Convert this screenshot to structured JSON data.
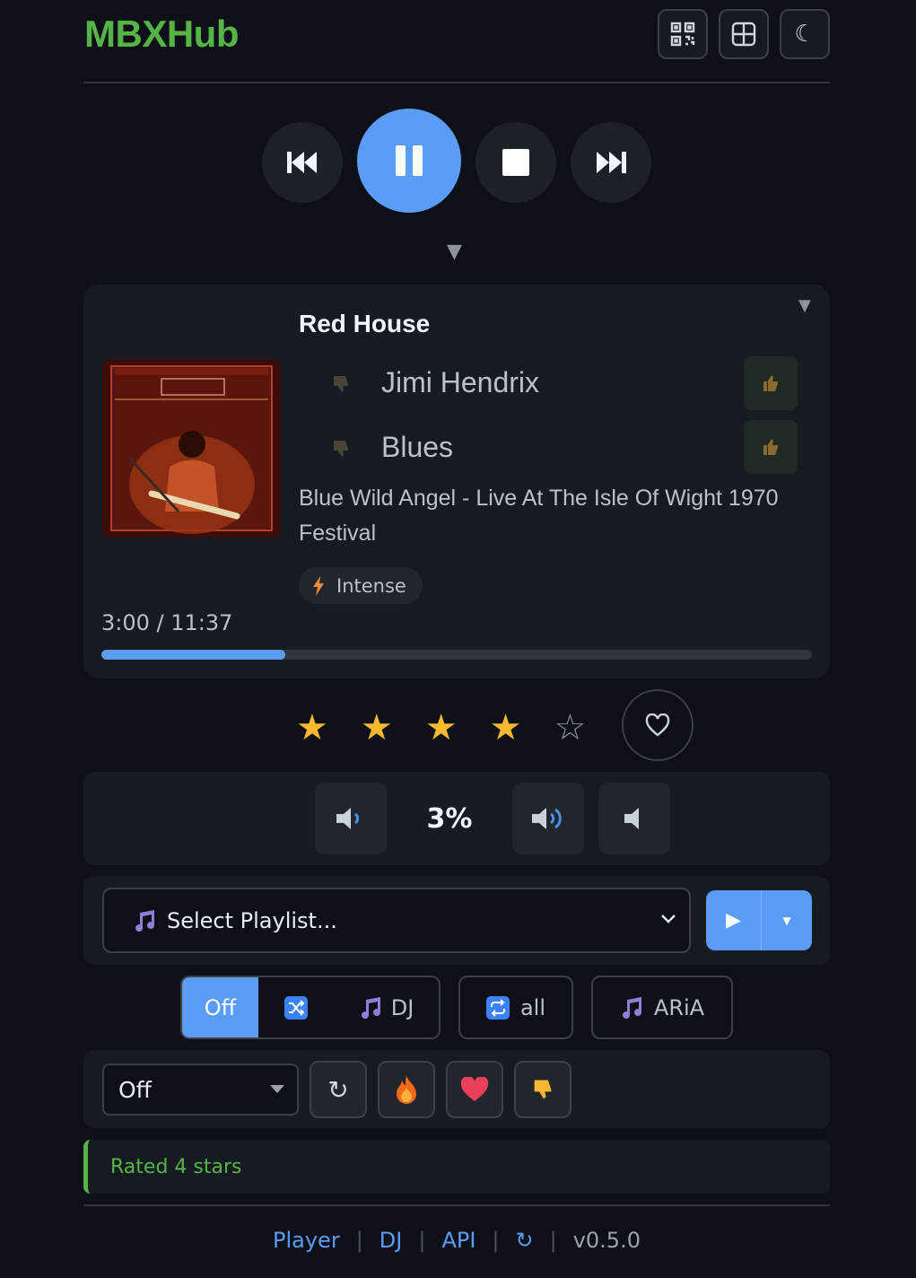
{
  "header": {
    "brand": "MBXHub",
    "buttons": [
      {
        "name": "qr-code-icon"
      },
      {
        "name": "grid-icon"
      },
      {
        "name": "moon-icon",
        "glyph": "☾"
      }
    ]
  },
  "transport": {
    "buttons": [
      "previous-icon",
      "pause-icon",
      "stop-icon",
      "next-icon"
    ],
    "expand_glyph": "▼"
  },
  "now_playing": {
    "title": "Red House",
    "artist": "Jimi Hendrix",
    "genre": "Blues",
    "album": "Blue Wild Angel - Live At The Isle Of Wight 1970 Festival",
    "mood": "Intense",
    "collapse_glyph": "▼",
    "time": "3:00 / 11:37",
    "progress_fraction": 0.259
  },
  "rating": {
    "stars": 4,
    "max": 5,
    "star_full": "★",
    "star_empty": "☆"
  },
  "volume": {
    "level": "3%"
  },
  "playlist": {
    "placeholder": "Select Playlist...",
    "play_glyph": "▶",
    "caret_glyph": "▼"
  },
  "modes": {
    "shuffle_off": "Off",
    "dj": "DJ",
    "repeat": "all",
    "aria": "ARiA"
  },
  "filters": {
    "selected": "Off",
    "refresh_glyph": "↻"
  },
  "status": {
    "message": "Rated 4 stars"
  },
  "footer": {
    "links": [
      "Player",
      "DJ",
      "API"
    ],
    "refresh_glyph": "↻",
    "version": "v0.5.0",
    "separator": "|"
  },
  "colors": {
    "accent": "#5b9cf6",
    "brand": "#56b346",
    "star": "#f5b82e",
    "background": "#0d1117",
    "card": "#161b22"
  }
}
